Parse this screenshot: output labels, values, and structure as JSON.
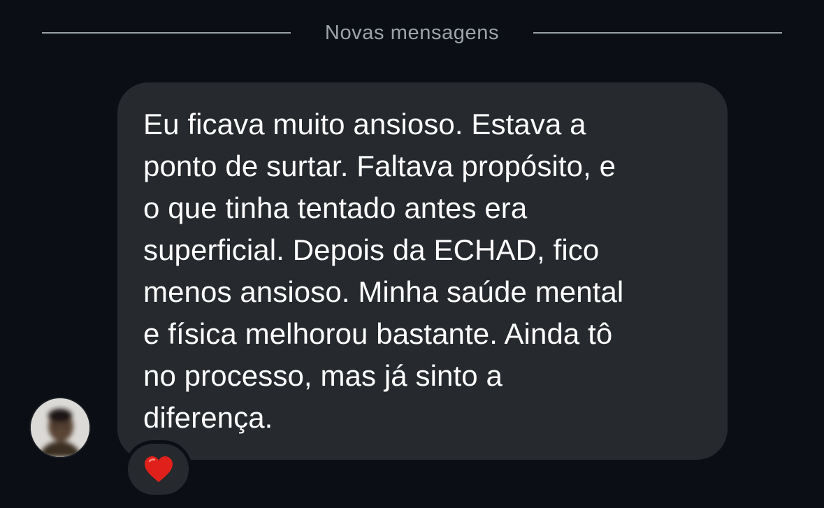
{
  "divider": {
    "label": "Novas mensagens"
  },
  "message": {
    "text": "Eu ficava muito ansioso. Estava a\nponto de surtar. Faltava propósito, e\no que tinha tentado antes era\nsuperficial. Depois da ECHAD, fico\nmenos ansioso. Minha saúde mental\ne física melhorou bastante. Ainda tô\nno processo, mas já sinto a\ndiferença.",
    "reaction": {
      "icon": "heart-icon",
      "color": "#e0211b"
    }
  },
  "colors": {
    "background": "#0b0f15",
    "bubble": "#26292e",
    "divider_text": "#9ea3ab"
  }
}
